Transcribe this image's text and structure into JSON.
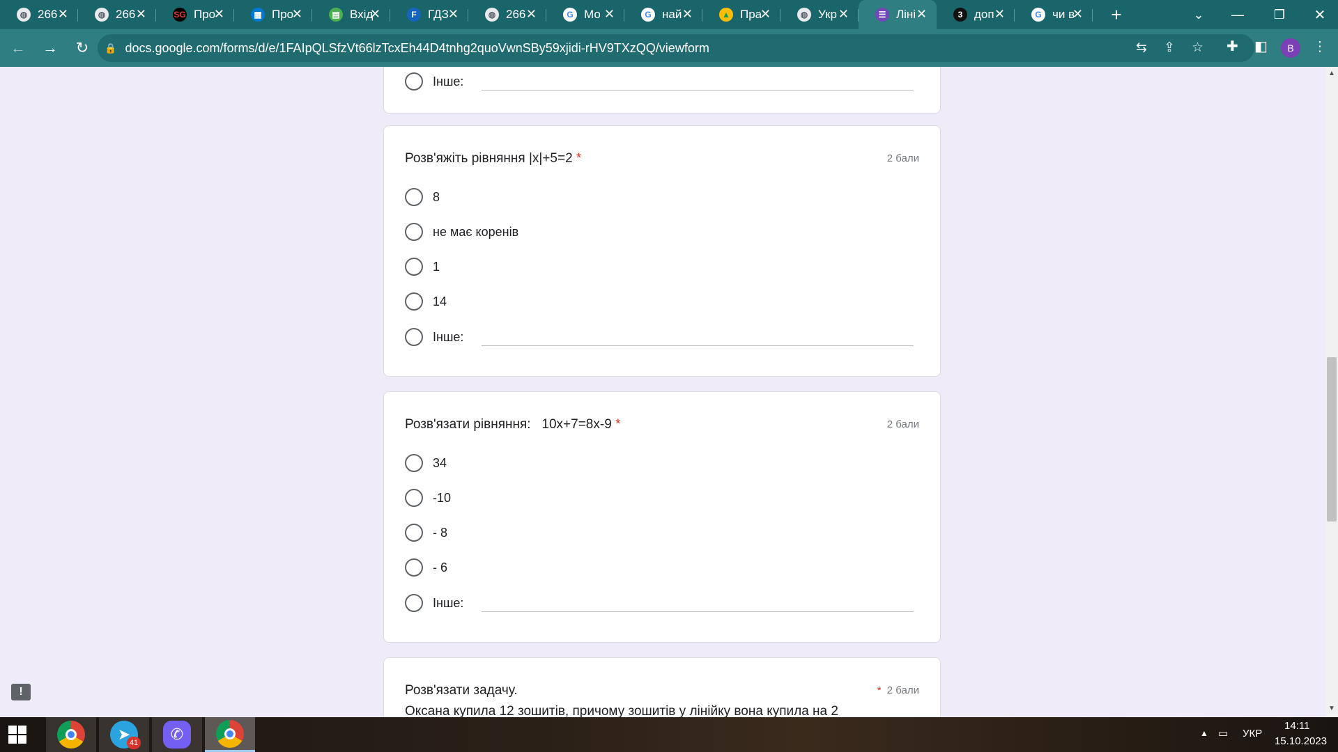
{
  "browser": {
    "tabs": [
      {
        "label": "266",
        "icon": "globe-icon"
      },
      {
        "label": "266",
        "icon": "globe-icon"
      },
      {
        "label": "Про",
        "icon": "sg-icon"
      },
      {
        "label": "Про",
        "icon": "windows-store-icon"
      },
      {
        "label": "Вхід",
        "icon": "folder-icon"
      },
      {
        "label": "ГДЗ",
        "icon": "f-icon"
      },
      {
        "label": "266",
        "icon": "globe-icon"
      },
      {
        "label": "Мо",
        "icon": "google-icon"
      },
      {
        "label": "най",
        "icon": "google-icon"
      },
      {
        "label": "Пра",
        "icon": "drive-icon"
      },
      {
        "label": "Укр",
        "icon": "globe-icon"
      },
      {
        "label": "Ліні",
        "icon": "forms-icon",
        "active": true
      },
      {
        "label": "доп",
        "icon": "z-icon"
      },
      {
        "label": "чи в",
        "icon": "google-icon"
      }
    ],
    "url": "docs.google.com/forms/d/e/1FAIpQLSfzVt66lzTcxEh44D4tnhg2quoVwnSBy59xjidi-rHV9TXzQQ/viewform",
    "profile_initial": "B"
  },
  "form": {
    "other_label": "Інше:",
    "prev_card": {
      "other_label": "Інше:"
    },
    "questions": [
      {
        "title": "Розв'яжіть рівняння |x|+5=2",
        "required": "*",
        "points": "2 бали",
        "options": [
          "8",
          "не має коренів",
          "1",
          "14"
        ]
      },
      {
        "title": "Розв'язати рівняння:   10x+7=8x-9",
        "required": "*",
        "points": "2 бали",
        "options": [
          "34",
          "-10",
          "- 8",
          "- 6"
        ]
      },
      {
        "title": "Розв'язати задачу.",
        "required": "*",
        "points": "2 бали",
        "body": "Оксана купила 12 зошитів, причому зошитів у лінійку вона купила на 2"
      }
    ]
  },
  "taskbar": {
    "apps": [
      {
        "name": "chrome-app",
        "badge": ""
      },
      {
        "name": "telegram-app",
        "badge": "41"
      },
      {
        "name": "viber-app",
        "badge": ""
      },
      {
        "name": "chrome-app-2",
        "badge": ""
      }
    ],
    "language": "УКР",
    "time": "14:11",
    "date": "15.10.2023"
  }
}
